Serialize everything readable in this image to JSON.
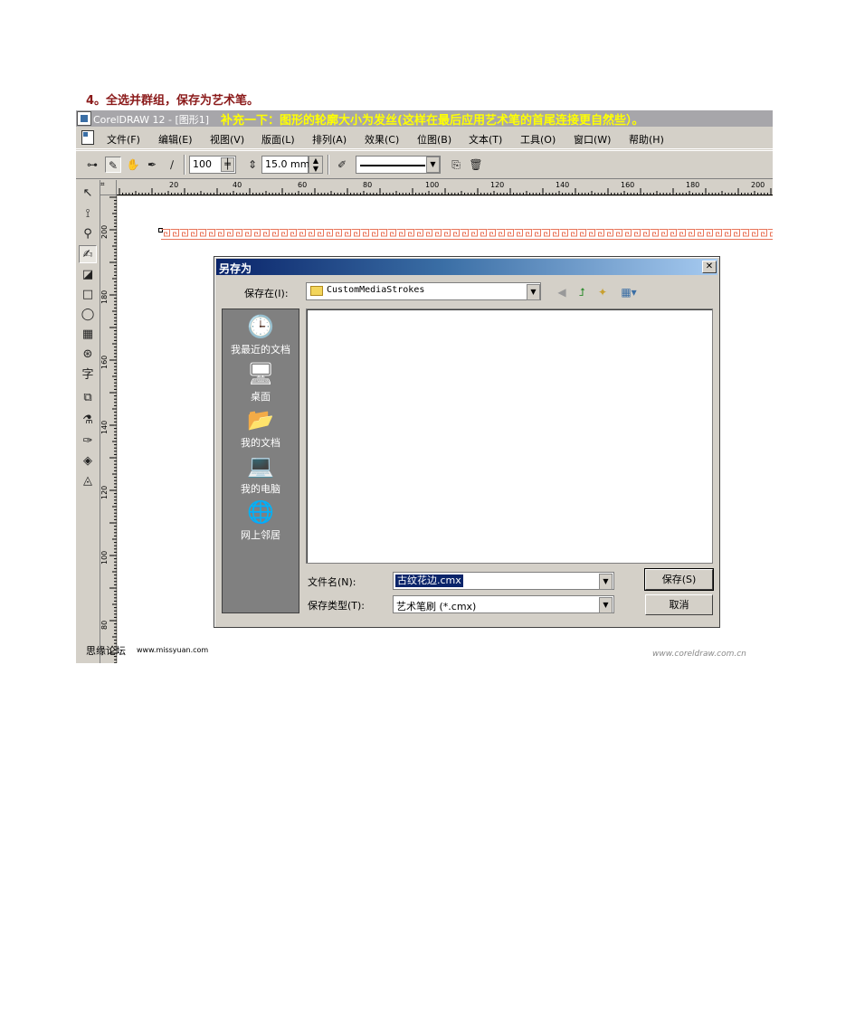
{
  "heading": "4。全选并群组，保存为艺术笔。",
  "window": {
    "title": "CorelDRAW 12 - [图形1]",
    "note": "补充一下：图形的轮廓大小为发丝(这样在最后应用艺术笔的首尾连接更自然些）。"
  },
  "menu": [
    "文件(F)",
    "编辑(E)",
    "视图(V)",
    "版面(L)",
    "排列(A)",
    "效果(C)",
    "位图(B)",
    "文本(T)",
    "工具(O)",
    "窗口(W)",
    "帮助(H)"
  ],
  "propbar": {
    "smoothness": "100",
    "width": "15.0 mm"
  },
  "ruler": {
    "h_labels": [
      "20",
      "40",
      "60",
      "80",
      "100",
      "120",
      "140",
      "160",
      "180",
      "200"
    ],
    "v_labels": [
      "200",
      "180",
      "160",
      "140",
      "120",
      "100",
      "80"
    ]
  },
  "dialog": {
    "title": "另存为",
    "save_in_label": "保存在(I):",
    "save_in_value": "CustomMediaStrokes",
    "places": [
      "我最近的文档",
      "桌面",
      "我的文档",
      "我的电脑",
      "网上邻居"
    ],
    "filename_label": "文件名(N):",
    "filename_value": "古纹花边.cmx",
    "filetype_label": "保存类型(T):",
    "filetype_value": "艺术笔刷 (*.cmx)",
    "save_button": "保存(S)",
    "cancel_button": "取消"
  },
  "footer": {
    "forum_name": "思缘论坛",
    "forum_url": "www.missyuan.com",
    "watermark": "www.coreldraw.com.cn"
  },
  "colors": {
    "heading": "#8b1a1a",
    "note": "#ffff00",
    "border_pattern": "#e8755a",
    "dialog_title_start": "#0a246a",
    "dialog_title_end": "#a6caf0"
  }
}
